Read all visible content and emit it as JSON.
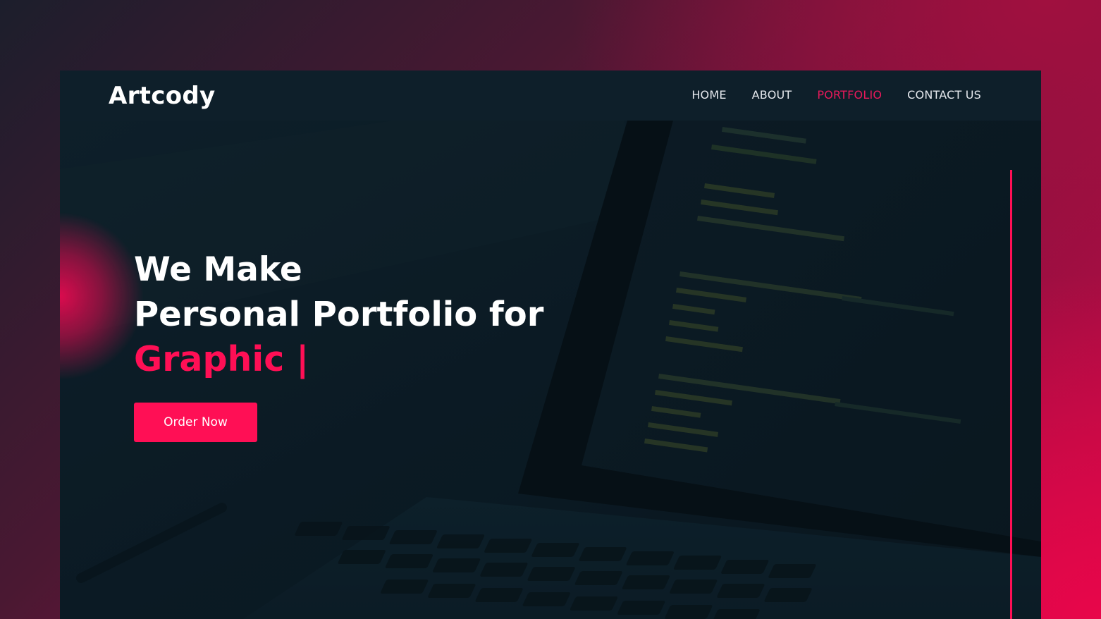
{
  "brand": {
    "name": "Artcody"
  },
  "nav": {
    "items": [
      {
        "label": "HOME",
        "active": false
      },
      {
        "label": "ABOUT",
        "active": false
      },
      {
        "label": "PORTFOLIO",
        "active": true
      },
      {
        "label": "CONTACT US",
        "active": false
      }
    ]
  },
  "hero": {
    "line1": "We Make",
    "line2": "Personal Portfolio for",
    "line3": "Graphic |",
    "cta_label": "Order Now"
  },
  "colors": {
    "accent": "#ff0f55",
    "navbar": "#0e1f2a",
    "hero_bg": "#0c1b24",
    "text": "#ffffff"
  }
}
